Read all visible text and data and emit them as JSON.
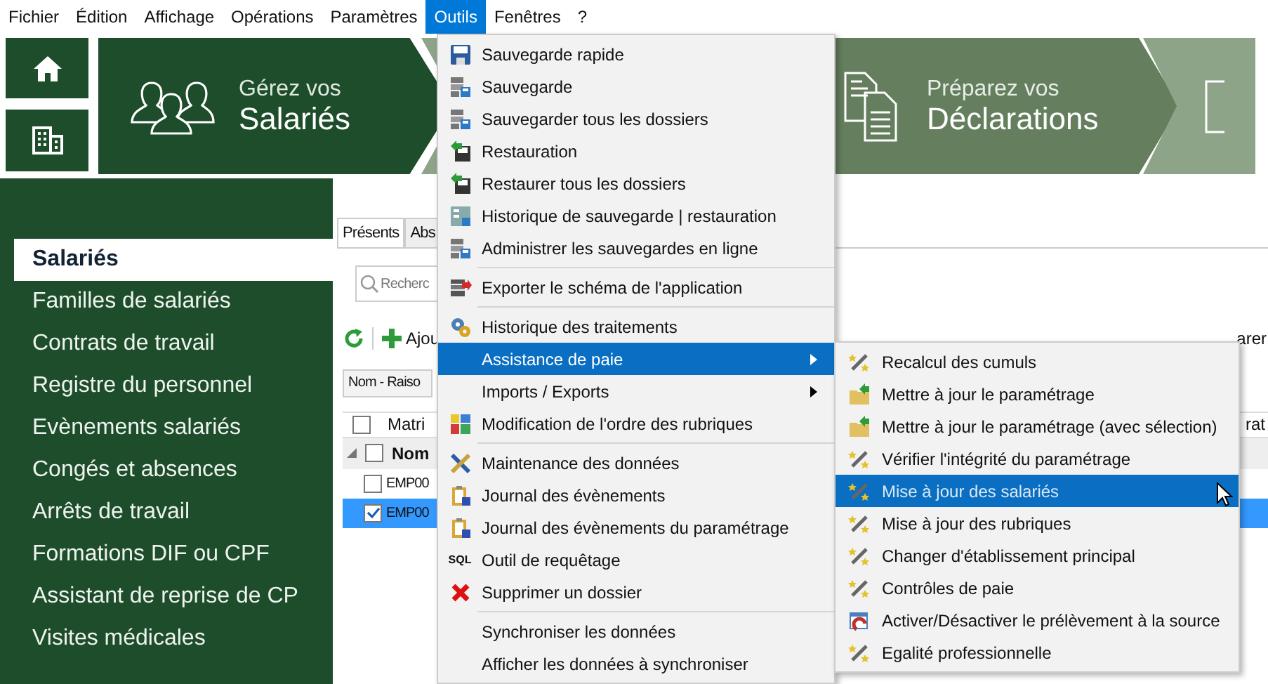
{
  "menubar": [
    {
      "label": "Fichier",
      "selected": false
    },
    {
      "label": "Édition",
      "selected": false
    },
    {
      "label": "Affichage",
      "selected": false
    },
    {
      "label": "Opérations",
      "selected": false
    },
    {
      "label": "Paramètres",
      "selected": false
    },
    {
      "label": "Outils",
      "selected": true
    },
    {
      "label": "Fenêtres",
      "selected": false
    },
    {
      "label": "?",
      "selected": false
    }
  ],
  "banners": [
    {
      "line1": "Gérez vos",
      "line2": "Salariés"
    },
    {
      "line1": "Préparez vos",
      "line2": "Déclarations"
    }
  ],
  "sidebar": {
    "items": [
      {
        "label": "Salariés",
        "selected": true
      },
      {
        "label": "Familles de salariés",
        "selected": false
      },
      {
        "label": "Contrats de travail",
        "selected": false
      },
      {
        "label": "Registre du personnel",
        "selected": false
      },
      {
        "label": "Evènements salariés",
        "selected": false
      },
      {
        "label": "Congés et absences",
        "selected": false
      },
      {
        "label": "Arrêts de travail",
        "selected": false
      },
      {
        "label": "Formations DIF ou CPF",
        "selected": false
      },
      {
        "label": "Assistant de reprise de CP",
        "selected": false
      },
      {
        "label": "Visites médicales",
        "selected": false
      }
    ]
  },
  "tabs": [
    {
      "label": "Présents",
      "selected": true
    },
    {
      "label": "Abs",
      "selected": false
    }
  ],
  "search": {
    "placeholder": "Recherc"
  },
  "toolbar": {
    "add": "Ajou",
    "right_text": "arer"
  },
  "sort_button": "Nom - Raiso",
  "grid": {
    "columns": [
      "Matri",
      "rat"
    ],
    "header_checked": false,
    "group": {
      "label": "Nom",
      "expanded": true,
      "checked": false
    },
    "rows": [
      {
        "cell": "EMP00",
        "checked": false,
        "selected": false
      },
      {
        "cell": "EMP00",
        "checked": true,
        "selected": true
      }
    ]
  },
  "menu": {
    "groups": [
      [
        {
          "label": "Sauvegarde rapide",
          "selected": false,
          "submenu": false
        },
        {
          "label": "Sauvegarde",
          "selected": false,
          "submenu": false
        },
        {
          "label": "Sauvegarder tous les dossiers",
          "selected": false,
          "submenu": false
        },
        {
          "label": "Restauration",
          "selected": false,
          "submenu": false
        },
        {
          "label": "Restaurer tous les dossiers",
          "selected": false,
          "submenu": false
        },
        {
          "label": "Historique de sauvegarde | restauration",
          "selected": false,
          "submenu": false
        },
        {
          "label": "Administrer les sauvegardes en ligne",
          "selected": false,
          "submenu": false
        }
      ],
      [
        {
          "label": "Exporter le schéma de l'application",
          "selected": false,
          "submenu": false
        }
      ],
      [
        {
          "label": "Historique des traitements",
          "selected": false,
          "submenu": false
        },
        {
          "label": "Assistance de paie",
          "selected": true,
          "submenu": true
        },
        {
          "label": "Imports / Exports",
          "selected": false,
          "submenu": true
        },
        {
          "label": "Modification de l'ordre des rubriques",
          "selected": false,
          "submenu": false
        }
      ],
      [
        {
          "label": "Maintenance des données",
          "selected": false,
          "submenu": false
        },
        {
          "label": "Journal des évènements",
          "selected": false,
          "submenu": false
        },
        {
          "label": "Journal des évènements du paramétrage",
          "selected": false,
          "submenu": false
        },
        {
          "label": "Outil de requêtage",
          "selected": false,
          "submenu": false,
          "icon_text": "SQL"
        },
        {
          "label": "Supprimer un dossier",
          "selected": false,
          "submenu": false
        }
      ],
      [
        {
          "label": "Synchroniser les données",
          "selected": false,
          "submenu": false
        },
        {
          "label": "Afficher les données à synchroniser",
          "selected": false,
          "submenu": false
        }
      ]
    ]
  },
  "submenu": {
    "items": [
      {
        "label": "Recalcul des cumuls",
        "selected": false
      },
      {
        "label": "Mettre à jour le paramétrage",
        "selected": false
      },
      {
        "label": "Mettre à jour le paramétrage (avec sélection)",
        "selected": false
      },
      {
        "label": "Vérifier l'intégrité du paramétrage",
        "selected": false
      },
      {
        "label": "Mise à jour des salariés",
        "selected": true
      },
      {
        "label": "Mise à jour des rubriques",
        "selected": false
      },
      {
        "label": "Changer d'établissement principal",
        "selected": false
      },
      {
        "label": "Contrôles de paie",
        "selected": false
      },
      {
        "label": "Activer/Désactiver le prélèvement à la source",
        "selected": false
      },
      {
        "label": "Egalité professionnelle",
        "selected": false
      }
    ]
  }
}
